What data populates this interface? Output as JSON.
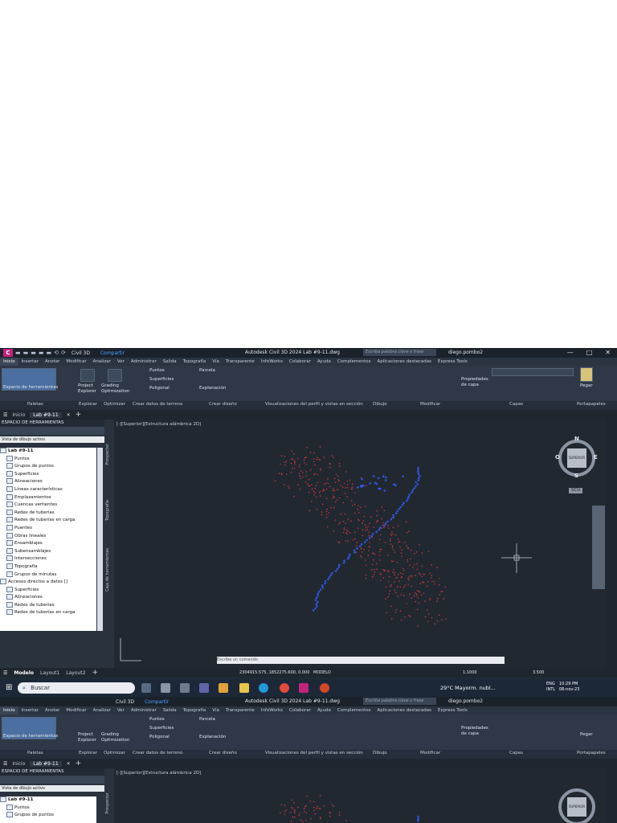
{
  "app": {
    "qa_workspace": "Civil 3D",
    "share_label": "Compartir",
    "title": "Autodesk Civil 3D 2024   Lab #9-11.dwg",
    "search_placeholder": "Escriba palabra clave o frase",
    "user": "diego.pombo2",
    "window_controls": [
      "—",
      "□",
      "✕"
    ]
  },
  "ribbon_tabs": [
    "Inicio",
    "Insertar",
    "Anotar",
    "Modificar",
    "Analizar",
    "Ver",
    "Administrar",
    "Salida",
    "Topografía",
    "Vía",
    "Transparente",
    "InfoWorks",
    "Colaborar",
    "Ayuda",
    "Complementos",
    "Aplicaciones destacadas",
    "Express Tools"
  ],
  "ribbon": {
    "tool_space": "Espacio de herramientas",
    "project_explorer": "Project Explorer",
    "grading_optimization": "Grading Optimization",
    "puntos": "Puntos",
    "superficies": "Superficies",
    "poligonal": "Poligonal",
    "parcela": "Parcela",
    "explanacion": "Explanación",
    "propiedades_capa": "Propiedades de capa",
    "pegar": "Pegar",
    "panels": [
      "Paletas",
      "Explorar",
      "Optimizar",
      "Crear datos de terreno",
      "Crear diseño",
      "Visualizaciones del perfil y vistas en sección",
      "Dibujo",
      "Modificar",
      "Capas",
      "Portapapeles"
    ]
  },
  "doc_tabs": [
    "Inicio",
    "Lab #9-11"
  ],
  "toolspace": {
    "title": "ESPACIO DE HERRAMIENTAS",
    "combo": "Vista de dibujo activo",
    "tree": [
      "Lab #9-11",
      "Puntos",
      "Grupos de puntos",
      "Superficies",
      "Alineaciones",
      "Líneas características",
      "Emplazamientos",
      "Cuencas vertientes",
      "Redes de tuberías",
      "Redes de tuberías en carga",
      "Puentes",
      "Obras lineales",
      "Ensamblajes",
      "Subensamblajes",
      "Intersecciones",
      "Topografía",
      "Grupos de minutas",
      "Accesos directos a datos []",
      "Superficies",
      "Alineaciones",
      "Redes de tuberías",
      "Redes de tuberías en carga"
    ],
    "vertical_tabs": [
      "Prospector",
      "Topografía",
      "Caja de herramientas"
    ]
  },
  "viewport": {
    "label": "[-][Superior][Estructura alámbrica 2D]",
    "compass": {
      "N": "N",
      "S": "S",
      "E": "E",
      "O": "O",
      "cube": "SUPERIOR",
      "wcs": "SCU"
    }
  },
  "command_placeholder": "Escriba un comando",
  "layout_tabs": [
    "Modelo",
    "Layout1",
    "Layout2"
  ],
  "status": {
    "coords": "2304915.575, 1852275.600, 0.000",
    "mode": "MODELO",
    "scale": "1:1000",
    "value": "3.500"
  },
  "taskbar": {
    "search": "Buscar",
    "weather": "29°C  Mayorm. nubl...",
    "lang": "ENG\nINTL",
    "time": "10:29 PM",
    "date": "08-nov-23"
  },
  "colors": {
    "accent": "#4aa3ff",
    "app_icon": "#c2247a",
    "canvas": "#212830"
  }
}
